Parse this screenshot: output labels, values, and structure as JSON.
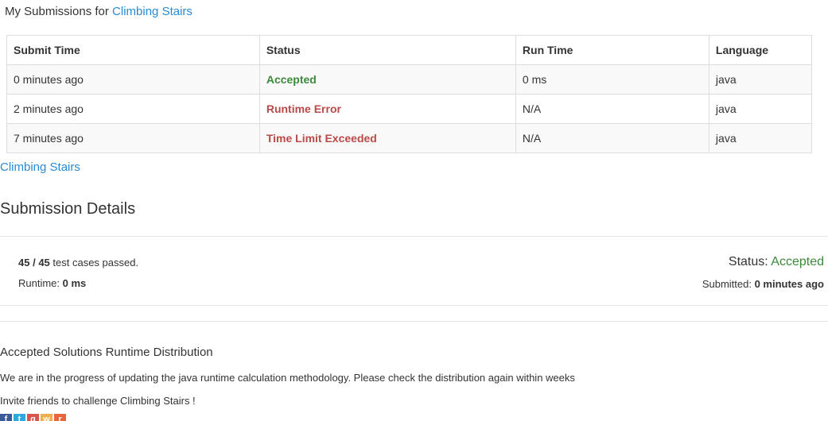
{
  "header": {
    "prefix": "My Submissions for",
    "problem_link": "Climbing Stairs"
  },
  "submissions_table": {
    "columns": [
      "Submit Time",
      "Status",
      "Run Time",
      "Language"
    ],
    "rows": [
      {
        "submit_time": "0 minutes ago",
        "status": "Accepted",
        "run_time": "0 ms",
        "language": "java"
      },
      {
        "submit_time": "2 minutes ago",
        "status": "Runtime Error",
        "run_time": "N/A",
        "language": "java"
      },
      {
        "submit_time": "7 minutes ago",
        "status": "Time Limit Exceeded",
        "run_time": "N/A",
        "language": "java"
      }
    ]
  },
  "problem_link_bottom": "Climbing Stairs",
  "details": {
    "title": "Submission Details",
    "passed": "45",
    "separator": " / ",
    "total": "45",
    "passed_suffix": " test cases passed.",
    "runtime_label": "Runtime: ",
    "runtime_value": "0 ms",
    "status_label": "Status: ",
    "status_value": "Accepted",
    "submitted_label": "Submitted: ",
    "submitted_value": "0 minutes ago"
  },
  "distribution": {
    "title": "Accepted Solutions Runtime Distribution",
    "note": "We are in the progress of updating the java runtime calculation methodology. Please check the distribution again within weeks",
    "invite": "Invite friends to challenge Climbing Stairs !"
  },
  "share": [
    {
      "icon": "facebook-icon",
      "glyph": "f",
      "color": "#3b5998"
    },
    {
      "icon": "twitter-icon",
      "glyph": "t",
      "color": "#2fa8dd"
    },
    {
      "icon": "google-plus-icon",
      "glyph": "g",
      "color": "#d9534f"
    },
    {
      "icon": "weibo-icon",
      "glyph": "w",
      "color": "#f0ad4e"
    },
    {
      "icon": "renren-icon",
      "glyph": "r",
      "color": "#e8653c"
    }
  ],
  "colors": {
    "link": "#2a8ad4",
    "accepted": "#3c8a3c",
    "error": "#b94a48"
  }
}
